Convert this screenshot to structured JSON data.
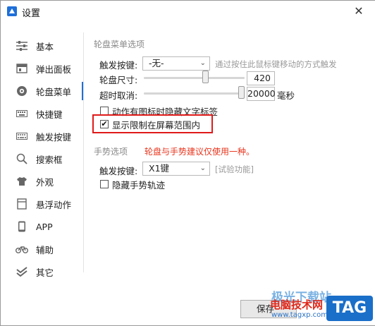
{
  "window": {
    "title": "设置",
    "close_glyph": "✕"
  },
  "sidebar": {
    "items": [
      {
        "label": "基本",
        "icon": "sliders-icon"
      },
      {
        "label": "弹出面板",
        "icon": "panel-icon"
      },
      {
        "label": "轮盘菜单",
        "icon": "wheel-icon",
        "active": true
      },
      {
        "label": "快捷键",
        "icon": "keyboard-icon"
      },
      {
        "label": "触发按键",
        "icon": "keyboard-trigger-icon"
      },
      {
        "label": "搜索框",
        "icon": "search-icon"
      },
      {
        "label": "外观",
        "icon": "shirt-icon"
      },
      {
        "label": "悬浮动作",
        "icon": "float-window-icon"
      },
      {
        "label": "APP",
        "icon": "phone-icon"
      },
      {
        "label": "辅助",
        "icon": "bicycle-icon"
      },
      {
        "label": "其它",
        "icon": "double-check-icon"
      }
    ]
  },
  "wheel_menu": {
    "section_title": "轮盘菜单选项",
    "trigger_label": "触发按键:",
    "trigger_value": "-无-",
    "trigger_hint": "通过按住此鼠标键移动的方式触发",
    "size_label": "轮盘尺寸:",
    "size_value": "420",
    "size_fraction": 0.62,
    "timeout_label": "超时取消:",
    "timeout_value": "20000",
    "timeout_unit": "毫秒",
    "timeout_fraction": 1.0,
    "hide_labels_text": "动作有图标时隐藏文字标签",
    "hide_labels_checked": false,
    "limit_screen_text": "显示限制在屏幕范围内",
    "limit_screen_checked": true
  },
  "gesture": {
    "section_title": "手势选项",
    "warning": "轮盘与手势建议仅使用一种。",
    "trigger_label": "触发按键:",
    "trigger_value": "X1键",
    "trigger_hint": "[试验功能]",
    "hide_trail_text": "隐藏手势轨迹",
    "hide_trail_checked": false
  },
  "footer": {
    "ok_label": "保存"
  },
  "watermark": {
    "line1": "极光下载站",
    "line2": "电脑技术网",
    "url": "www.tagxp.com",
    "logo": "TAG"
  },
  "colors": {
    "accent": "#1e6fd9",
    "warning": "#e8341c",
    "highlight": "#e01a1a"
  }
}
